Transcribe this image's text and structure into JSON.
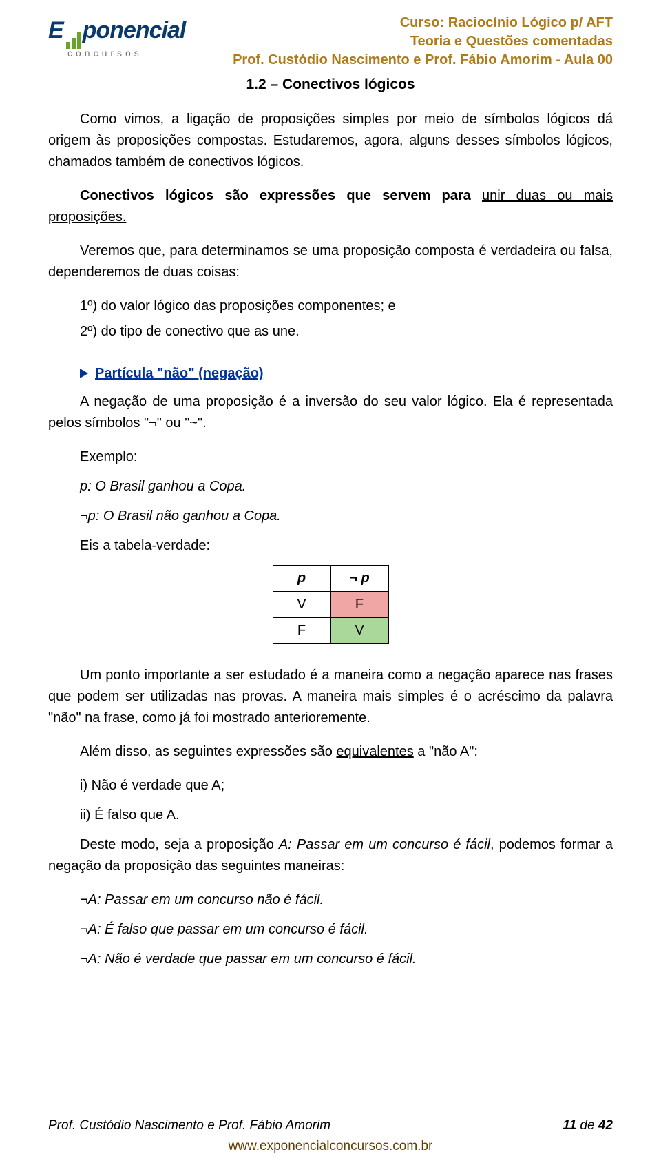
{
  "logo": {
    "brand_pre": "E",
    "brand_mid": "x",
    "brand_post": "ponencial",
    "sub": "concursos"
  },
  "header": {
    "line1": "Curso: Raciocínio Lógico p/ AFT",
    "line2": "Teoria e Questões comentadas",
    "line3": "Prof. Custódio Nascimento e Prof. Fábio Amorim - Aula 00"
  },
  "section_title": "1.2 – Conectivos lógicos",
  "p1": "Como vimos, a ligação de proposições simples por meio de símbolos lógicos dá origem às proposições compostas. Estudaremos, agora, alguns desses símbolos lógicos, chamados também de conectivos lógicos.",
  "p2_a": "Conectivos lógicos são expressões que servem para ",
  "p2_u": "unir duas ou mais proposições.",
  "p3": "Veremos que, para determinamos se uma proposição composta é verdadeira ou falsa, dependeremos de duas coisas:",
  "li1": "1º) do valor lógico das proposições componentes; e",
  "li2": "2º) do tipo de conectivo que as une.",
  "bullet": "Partícula \"não\" (negação)",
  "p4": "A negação de uma proposição é a inversão do seu valor lógico. Ela é representada pelos símbolos \"¬\" ou \"~\".",
  "ex_label": "Exemplo:",
  "ex_p": "p: O Brasil ganhou a Copa.",
  "ex_np": "¬p: O Brasil não ganhou a Copa.",
  "tv_intro": "Eis a tabela-verdade:",
  "tv": {
    "h1": "p",
    "h2": "¬ p",
    "r1c1": "V",
    "r1c2": "F",
    "r2c1": "F",
    "r2c2": "V"
  },
  "p5_a": "Um ponto importante a ser estudado é a maneira como a negação aparece nas frases que podem ser utilizadas nas provas. A maneira mais simples é o acréscimo da palavra \"não\" na frase, como já foi mostrado anterioremente.",
  "p6_a": "Além disso, as seguintes expressões são ",
  "p6_u": "equivalentes",
  "p6_b": " a \"não A\":",
  "eq1": "i) Não é verdade que A;",
  "eq2": "ii) É falso que A.",
  "p7_a": "Deste modo, seja a proposição ",
  "p7_i": "A: Passar em um concurso é fácil",
  "p7_b": ", podemos formar a negação da proposição das seguintes maneiras:",
  "neg1": "¬A: Passar em um concurso não é fácil.",
  "neg2": "¬A: É falso que passar em um concurso é fácil.",
  "neg3": "¬A: Não é verdade que passar em um concurso é fácil.",
  "footer": {
    "left": "Prof. Custódio Nascimento e Prof. Fábio Amorim",
    "right_a": "11",
    "right_b": " de ",
    "right_c": "42",
    "url": "www.exponencialconcursos.com.br"
  }
}
